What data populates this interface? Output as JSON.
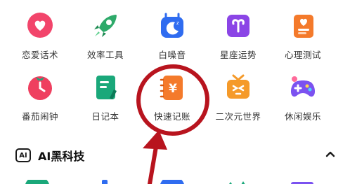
{
  "apps_row1": [
    {
      "label": "恋爱话术",
      "icon": "heart-chat-icon",
      "color": "#f2456b"
    },
    {
      "label": "效率工具",
      "icon": "rocket-icon",
      "color": "#2eaa6a"
    },
    {
      "label": "白噪音",
      "icon": "moon-sleep-icon",
      "color": "#2f6cf0"
    },
    {
      "label": "星座运势",
      "icon": "aries-icon",
      "color": "#8b45e6"
    },
    {
      "label": "心理测试",
      "icon": "clipboard-heart-icon",
      "color": "#f47a2b"
    }
  ],
  "apps_row2": [
    {
      "label": "番茄闹钟",
      "icon": "tomato-clock-icon",
      "color": "#ef3f5f"
    },
    {
      "label": "日记本",
      "icon": "diary-icon",
      "color": "#1aa87a"
    },
    {
      "label": "快速记账",
      "icon": "ledger-yuan-icon",
      "color": "#f47a2b"
    },
    {
      "label": "二次元世界",
      "icon": "anime-tv-icon",
      "color": "#f59a2a"
    },
    {
      "label": "休闲娱乐",
      "icon": "gamepad-icon",
      "color": "#7b52f0"
    }
  ],
  "section": {
    "badge": "AI",
    "title": "AI黑科技"
  },
  "colors": {
    "annotation": "#b8141e",
    "text": "#333333"
  }
}
